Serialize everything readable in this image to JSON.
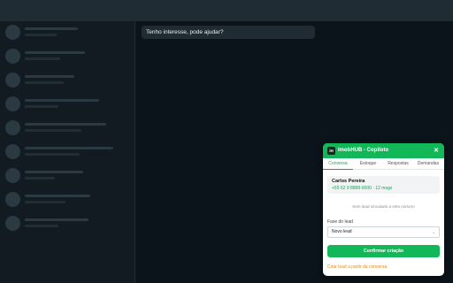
{
  "chat": {
    "message": "Tenho interesse, pode ajudar?"
  },
  "panel": {
    "logo": "iH",
    "title": "ImobHUB - Copiloto",
    "close": "✕",
    "tabs": [
      {
        "label": "Conversa",
        "active": true
      },
      {
        "label": "Estoque",
        "active": false
      },
      {
        "label": "Respostas",
        "active": false
      },
      {
        "label": "Demandas",
        "active": false
      }
    ],
    "contact": {
      "name": "Carlos Pereira",
      "phone": "+55 62 9 8888-0000 · 12 msgs"
    },
    "no_lead_text": "Sem lead vinculado a este número",
    "stage": {
      "label": "Fase do lead",
      "value": "Novo lead",
      "chevron": "⌄"
    },
    "confirm_label": "Confirmar criação",
    "create_link": "Criar lead a partir da conversa"
  },
  "colors": {
    "accent": "#12b857",
    "link": "#e38a1a",
    "background": "#0b141a"
  }
}
